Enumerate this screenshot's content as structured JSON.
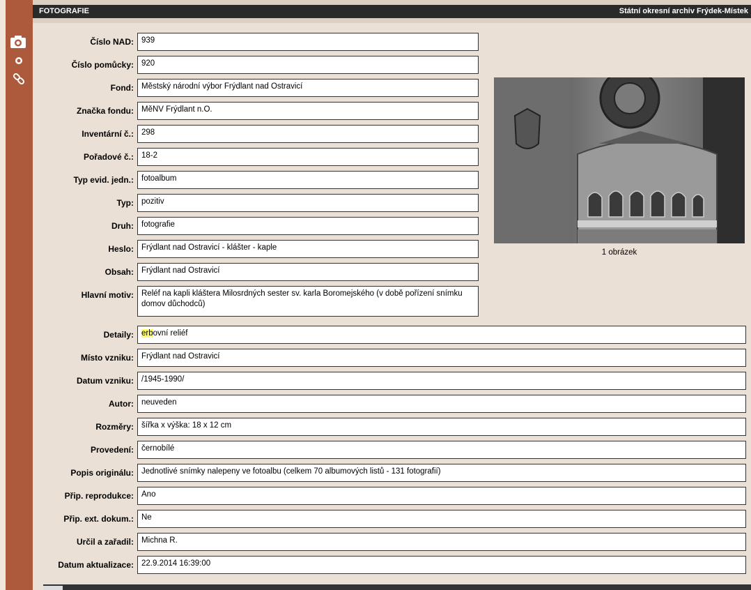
{
  "header": {
    "title": "FOTOGRAFIE",
    "archive": "Státní okresní archiv Frýdek-Místek"
  },
  "sidebar": {
    "icons": [
      "camera-icon",
      "dot-icon",
      "link-icon"
    ]
  },
  "fields": [
    {
      "label": "Číslo NAD:",
      "value": "939"
    },
    {
      "label": "Číslo pomůcky:",
      "value": "920"
    },
    {
      "label": "Fond:",
      "value": "Městský národní výbor Frýdlant nad Ostravicí"
    },
    {
      "label": "Značka fondu:",
      "value": "MěNV Frýdlant n.O."
    },
    {
      "label": "Inventární č.:",
      "value": "298"
    },
    {
      "label": "Pořadové č.:",
      "value": "18-2"
    },
    {
      "label": "Typ evid. jedn.:",
      "value": "fotoalbum"
    },
    {
      "label": "Typ:",
      "value": "pozitiv"
    },
    {
      "label": "Druh:",
      "value": "fotografie"
    },
    {
      "label": "Heslo:",
      "value": "Frýdlant nad Ostravicí - klášter - kaple"
    },
    {
      "label": "Obsah:",
      "value": "Frýdlant nad Ostravicí"
    },
    {
      "label": "Hlavní motiv:",
      "value": "Reléf na kapli kláštera Milosrdných sester sv. karla Boromejského (v době pořízení snímku domov důchodců)"
    },
    {
      "label": "Detaily:",
      "value_hl": "erb",
      "value": "ovní reliéf"
    },
    {
      "label": "Místo vzniku:",
      "value": "Frýdlant nad Ostravicí"
    },
    {
      "label": "Datum vzniku:",
      "value": "/1945-1990/"
    },
    {
      "label": "Autor:",
      "value": "neuveden"
    },
    {
      "label": "Rozměry:",
      "value": "šířka x výška: 18 x 12 cm"
    },
    {
      "label": "Provedení:",
      "value": "černobílé"
    },
    {
      "label": "Popis originálu:",
      "value": "Jednotlivé snímky nalepeny ve fotoalbu (celkem 70 albumových listů - 131 fotografií)"
    },
    {
      "label": "Přip. reprodukce:",
      "value": "Ano"
    },
    {
      "label": "Přip. ext. dokum.:",
      "value": "Ne"
    },
    {
      "label": "Určil a zařadil:",
      "value": "Michna R."
    },
    {
      "label": "Datum aktualizace:",
      "value": "22.9.2014 16:39:00"
    }
  ],
  "photo": {
    "caption": "1 obrázek"
  }
}
